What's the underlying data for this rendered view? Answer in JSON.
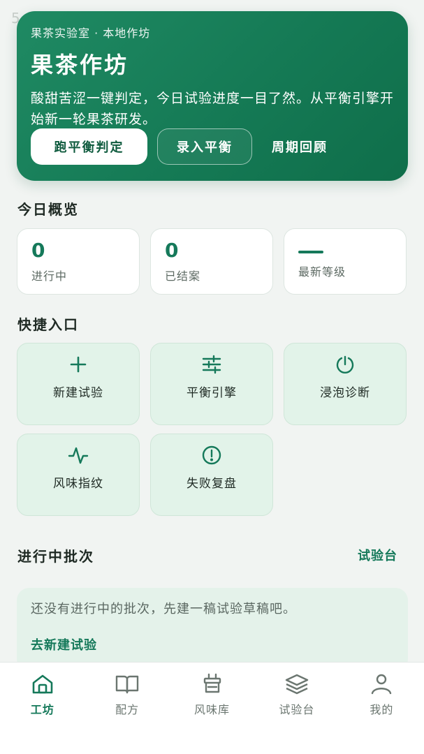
{
  "status_bar": {
    "ghost_text": "5"
  },
  "hero": {
    "eyebrow": "果茶实验室 · 本地作坊",
    "title": "果茶作坊",
    "description": "酸甜苦涩一键判定，今日试验进度一目了然。从平衡引擎开始新一轮果茶研发。",
    "primary_button": "跑平衡判定",
    "secondary_button": "录入平衡",
    "text_button": "周期回顾"
  },
  "overview": {
    "title": "今日概览",
    "stats": [
      {
        "value": "0",
        "label": "进行中"
      },
      {
        "value": "0",
        "label": "已结案"
      },
      {
        "value": "",
        "label": "最新等级"
      }
    ]
  },
  "quick_entry": {
    "title": "快捷入口",
    "tiles": [
      {
        "label": "新建试验",
        "icon": "plus-icon"
      },
      {
        "label": "平衡引擎",
        "icon": "sliders-icon"
      },
      {
        "label": "浸泡诊断",
        "icon": "timer-icon"
      },
      {
        "label": "风味指纹",
        "icon": "pulse-icon"
      },
      {
        "label": "失败复盘",
        "icon": "alert-circle-icon"
      }
    ]
  },
  "batches": {
    "title": "进行中批次",
    "link": "试验台",
    "empty_text": "还没有进行中的批次，先建一稿试验草稿吧。",
    "empty_action": "去新建试验"
  },
  "bottom_nav": {
    "items": [
      {
        "label": "工坊",
        "icon": "home-icon",
        "active": true
      },
      {
        "label": "配方",
        "icon": "book-icon",
        "active": false
      },
      {
        "label": "风味库",
        "icon": "cup-icon",
        "active": false
      },
      {
        "label": "试验台",
        "icon": "layers-icon",
        "active": false
      },
      {
        "label": "我的",
        "icon": "user-icon",
        "active": false
      }
    ]
  },
  "colors": {
    "brand": "#15795a",
    "hero_start": "#1f8a63",
    "hero_end": "#0f6e4a",
    "tile_bg": "#e2f3e9"
  }
}
